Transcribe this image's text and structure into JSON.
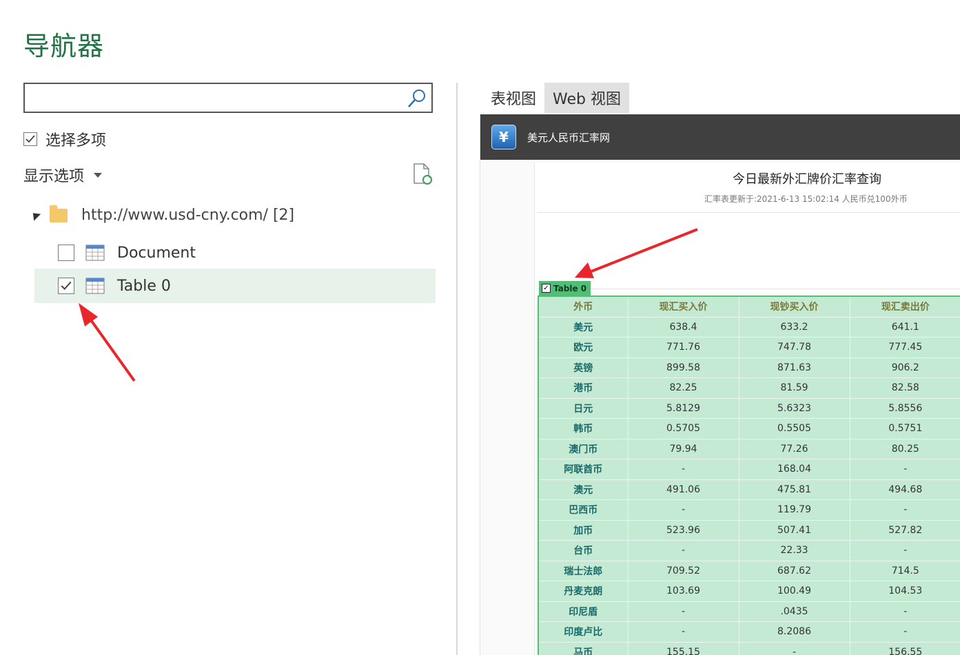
{
  "navigator": {
    "title": "导航器"
  },
  "search": {
    "placeholder": "",
    "value": ""
  },
  "multi_select": {
    "label": "选择多项",
    "checked": true
  },
  "display_options": {
    "label": "显示选项"
  },
  "tree": {
    "root": {
      "label": "http://www.usd-cny.com/ [2]"
    },
    "items": [
      {
        "label": "Document",
        "checked": false
      },
      {
        "label": "Table 0",
        "checked": true
      }
    ]
  },
  "tabs": [
    {
      "label": "表视图"
    },
    {
      "label": "Web 视图"
    }
  ],
  "web": {
    "site_name": "美元人民币汇率网",
    "heading": "今日最新外汇牌价汇率查询",
    "subheading": "汇率表更新于:2021-6-13 15:02:14 人民币兑100外币",
    "table_tag": "Table 0",
    "columns": [
      "外币",
      "现汇买入价",
      "现钞买入价",
      "现汇卖出价"
    ],
    "rows": [
      [
        "美元",
        "638.4",
        "633.2",
        "641.1"
      ],
      [
        "欧元",
        "771.76",
        "747.78",
        "777.45"
      ],
      [
        "英镑",
        "899.58",
        "871.63",
        "906.2"
      ],
      [
        "港币",
        "82.25",
        "81.59",
        "82.58"
      ],
      [
        "日元",
        "5.8129",
        "5.6323",
        "5.8556"
      ],
      [
        "韩币",
        "0.5705",
        "0.5505",
        "0.5751"
      ],
      [
        "澳门币",
        "79.94",
        "77.26",
        "80.25"
      ],
      [
        "阿联酋币",
        "-",
        "168.04",
        "-"
      ],
      [
        "澳元",
        "491.06",
        "475.81",
        "494.68"
      ],
      [
        "巴西币",
        "-",
        "119.79",
        "-"
      ],
      [
        "加币",
        "523.96",
        "507.41",
        "527.82"
      ],
      [
        "台币",
        "-",
        "22.33",
        "-"
      ],
      [
        "瑞士法郎",
        "709.52",
        "687.62",
        "714.5"
      ],
      [
        "丹麦克朗",
        "103.69",
        "100.49",
        "104.53"
      ],
      [
        "印尼盾",
        "-",
        ".0435",
        "-"
      ],
      [
        "印度卢比",
        "-",
        "8.2086",
        "-"
      ],
      [
        "马币",
        "155.15",
        "-",
        "156.55"
      ]
    ]
  },
  "colors": {
    "accent": "#217346",
    "selection": "#e6f2ea",
    "table_fill": "#c4ead3",
    "table_border": "#52bd75",
    "arrow": "#e8262b"
  }
}
